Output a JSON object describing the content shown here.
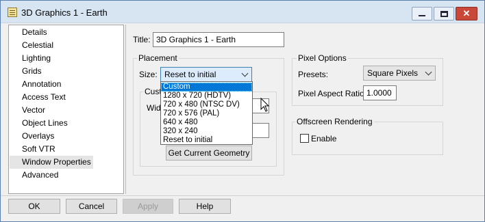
{
  "window": {
    "title": "3D Graphics 1 - Earth",
    "controls": [
      "minimize-icon",
      "maximize-icon",
      "close-icon"
    ],
    "close_glyph": "✕"
  },
  "nav": {
    "items": [
      {
        "label": "Details"
      },
      {
        "label": "Celestial"
      },
      {
        "label": "Lighting"
      },
      {
        "label": "Grids"
      },
      {
        "label": "Annotation"
      },
      {
        "label": "Access Text"
      },
      {
        "label": "Vector"
      },
      {
        "label": "Object Lines"
      },
      {
        "label": "Overlays"
      },
      {
        "label": "Soft VTR"
      },
      {
        "label": "Window Properties",
        "selected": true
      },
      {
        "label": "Advanced"
      }
    ]
  },
  "title_field": {
    "label": "Title:",
    "value": "3D Graphics 1 - Earth"
  },
  "placement": {
    "group_title": "Placement",
    "size_label": "Size:",
    "size_value": "Reset to initial",
    "custom_group_title": "Cust",
    "width_label": "Widt",
    "get_geometry_button": "Get Current Geometry",
    "dropdown_options": [
      "Custom",
      "1280 x 720  (HDTV)",
      "720 x 480 (NTSC DV)",
      "720 x 576 (PAL)",
      "640 x 480",
      "320 x 240",
      "Reset to initial"
    ],
    "dropdown_highlighted": "Custom"
  },
  "pixel_options": {
    "group_title": "Pixel Options",
    "presets_label": "Presets:",
    "presets_value": "Square Pixels",
    "aspect_label": "Pixel Aspect Ratio:",
    "aspect_value": "1.0000"
  },
  "offscreen": {
    "group_title": "Offscreen Rendering",
    "enable_label": "Enable",
    "enable_checked": false
  },
  "footer": {
    "ok": "OK",
    "cancel": "Cancel",
    "apply": "Apply",
    "help": "Help"
  },
  "colors": {
    "selection": "#0078d7",
    "titlebar": "#d7e4f2",
    "close_button": "#c9483a"
  }
}
